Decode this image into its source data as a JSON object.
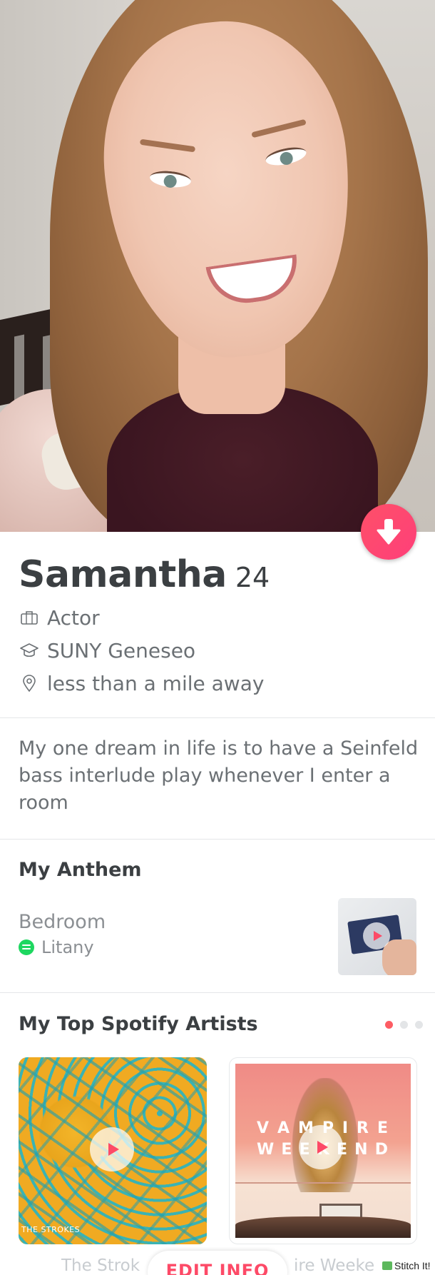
{
  "profile": {
    "name": "Samantha",
    "age": "24",
    "job": "Actor",
    "school": "SUNY Geneseo",
    "distance": "less than a mile away",
    "bio": "My one dream in life is to have a Seinfeld bass interlude play whenever I enter a room"
  },
  "anthem": {
    "title": "My Anthem",
    "song": "Bedroom",
    "artist": "Litany"
  },
  "top_artists": {
    "title": "My Top Spotify Artists",
    "page_count": 3,
    "active_page": 1,
    "cards": [
      {
        "album_caption": "THE STROKES",
        "name": "The Strokes"
      },
      {
        "album_text_line1": [
          "V",
          "A",
          "M",
          "P",
          "I",
          "R",
          "E"
        ],
        "album_text_line2": [
          "W",
          "E",
          "E",
          "K",
          "E",
          "N",
          "D"
        ],
        "name": "Vampire Weekend"
      }
    ],
    "ghost_labels": {
      "left": "The Strok",
      "right": "ire Weeke"
    }
  },
  "footer": {
    "edit_button": "EDIT INFO",
    "watermark": "Stitch It!"
  },
  "colors": {
    "accent": "#fd4a67",
    "text_dark": "#3b3f42",
    "text_muted": "#6b7074",
    "spotify_green": "#1ed760",
    "pager_active": "#fd5c63"
  },
  "icons": {
    "down_button": "arrow-down-icon",
    "job": "briefcase-icon",
    "school": "graduation-cap-icon",
    "distance": "location-pin-icon",
    "artist": "spotify-icon",
    "play": "play-icon"
  }
}
